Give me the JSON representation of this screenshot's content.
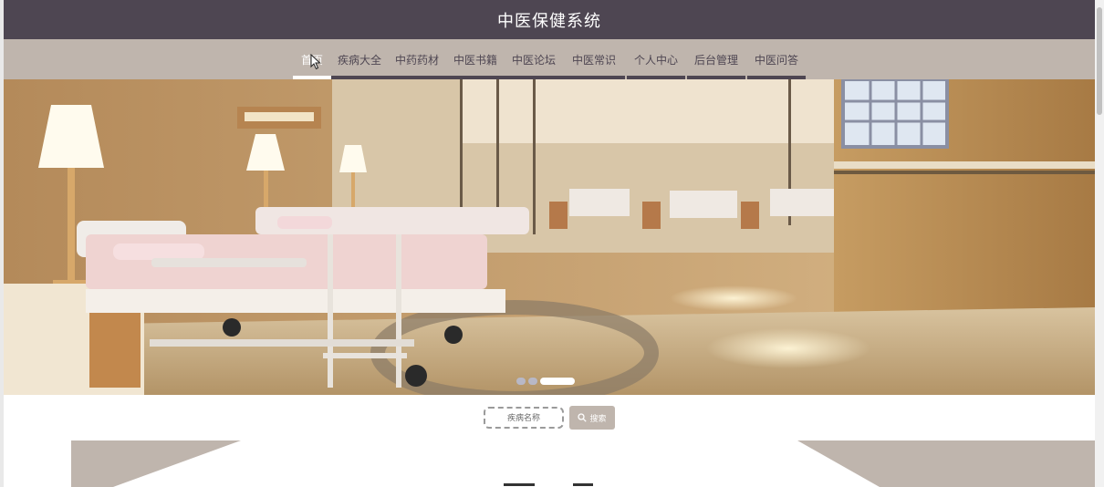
{
  "header": {
    "title": "中医保健系统"
  },
  "nav": {
    "items": [
      {
        "label": "首页",
        "active": true
      },
      {
        "label": "疾病大全",
        "active": false
      },
      {
        "label": "中药药材",
        "active": false
      },
      {
        "label": "中医书籍",
        "active": false
      },
      {
        "label": "中医论坛",
        "active": false
      },
      {
        "label": "中医常识",
        "active": false
      },
      {
        "label": "个人中心",
        "active": false
      },
      {
        "label": "后台管理",
        "active": false
      },
      {
        "label": "中医问答",
        "active": false
      }
    ]
  },
  "carousel": {
    "slide_count": 3,
    "active_index": 2
  },
  "search": {
    "placeholder": "疾病名称",
    "button_label": "搜索",
    "button_icon": "search-icon"
  },
  "colors": {
    "header_bg": "#4e4652",
    "nav_bg": "#bfb5ad",
    "accent": "#4e4652"
  }
}
